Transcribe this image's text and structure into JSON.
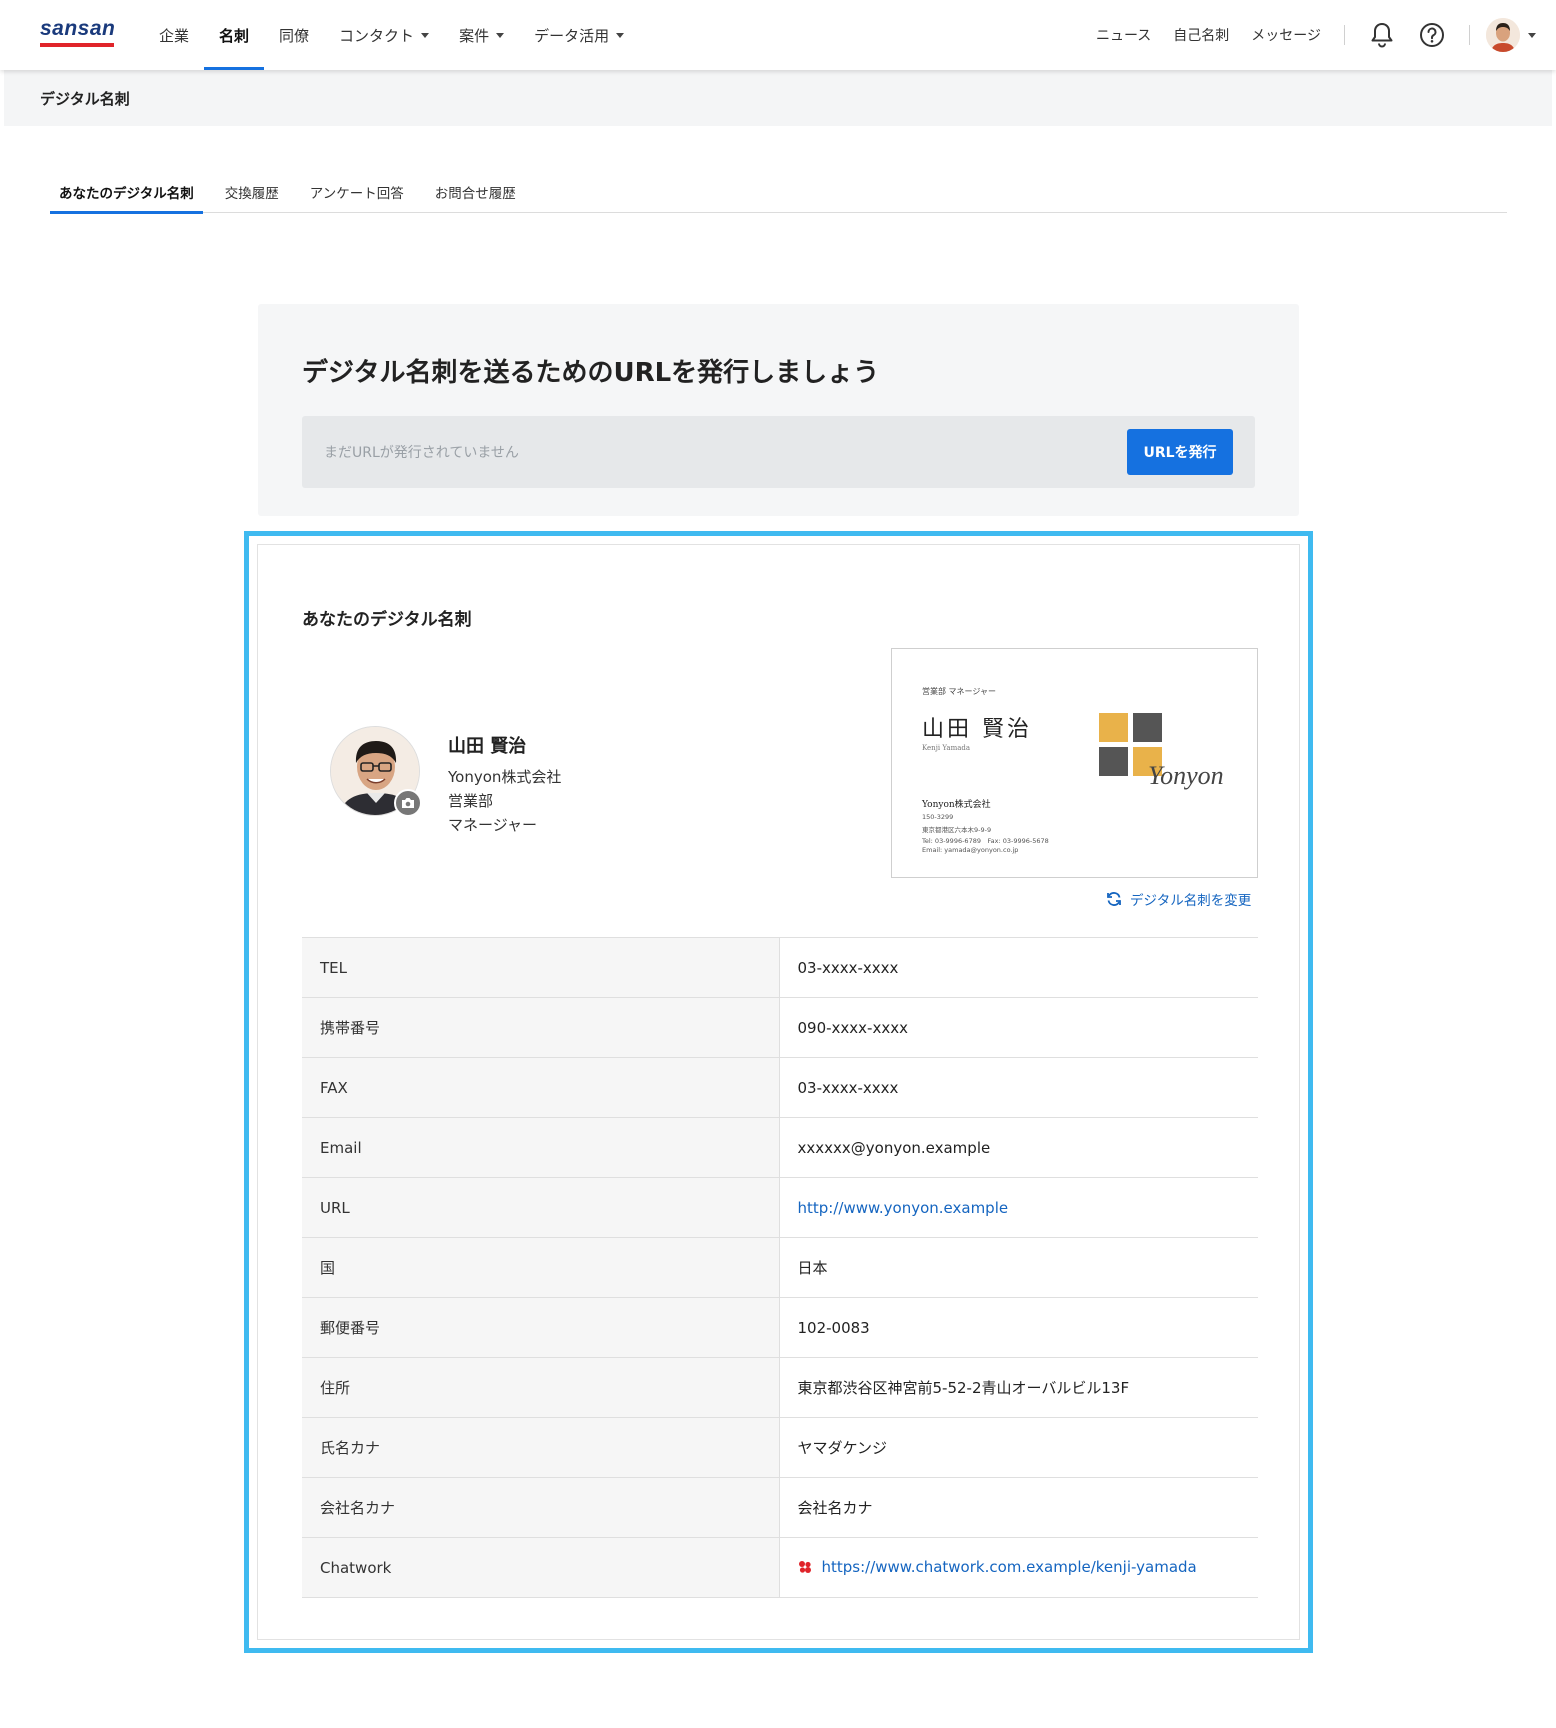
{
  "brand": {
    "logo_text": "sansan",
    "logo_red": "#e0242a",
    "logo_navy": "#1a3a7c"
  },
  "topnav": {
    "items": [
      {
        "label": "企業",
        "active": false
      },
      {
        "label": "名刺",
        "active": true
      },
      {
        "label": "同僚",
        "active": false
      },
      {
        "label": "コンタクト",
        "dropdown": true
      },
      {
        "label": "案件",
        "dropdown": true
      },
      {
        "label": "データ活用",
        "dropdown": true
      }
    ],
    "right_links": [
      "ニュース",
      "自己名刺",
      "メッセージ"
    ],
    "icons": [
      "bell-icon",
      "help-icon",
      "avatar",
      "chevron-down-icon"
    ]
  },
  "subheader": {
    "title": "デジタル名刺"
  },
  "tabs": [
    {
      "label": "あなたのデジタル名刺",
      "active": true
    },
    {
      "label": "交換履歴",
      "active": false
    },
    {
      "label": "アンケート回答",
      "active": false
    },
    {
      "label": "お問合せ履歴",
      "active": false
    }
  ],
  "url_panel": {
    "heading": "デジタル名刺を送るためのURLを発行しましょう",
    "placeholder": "まだURLが発行されていません",
    "button_label": "URLを発行"
  },
  "card": {
    "title": "あなたのデジタル名刺",
    "name": "山田 賢治",
    "company": "Yonyon株式会社",
    "department": "営業部",
    "position": "マネージャー",
    "change_link": "デジタル名刺を変更",
    "business_card": {
      "title": "営業部 マネージャー",
      "name": "山田 賢治",
      "roman_name": "Kenji Yamada",
      "logo_text": "Yonyon",
      "company": "Yonyon株式会社",
      "postal": "150-3299",
      "address": "東京都港区六本木9-9-9",
      "tel_fax": "Tel: 03-9996-6789　Fax: 03-9996-5678",
      "email": "Email: yamada@yonyon.co.jp",
      "logo_colors": {
        "gold": "#e9b24a",
        "gray": "#555555"
      }
    },
    "fields": [
      {
        "label": "TEL",
        "value": "03-xxxx-xxxx"
      },
      {
        "label": "携帯番号",
        "value": "090-xxxx-xxxx"
      },
      {
        "label": "FAX",
        "value": "03-xxxx-xxxx"
      },
      {
        "label": "Email",
        "value": "xxxxxx@yonyon.example"
      },
      {
        "label": "URL",
        "value": "http://www.yonyon.example",
        "link": true
      },
      {
        "label": "国",
        "value": "日本"
      },
      {
        "label": "郵便番号",
        "value": "102-0083"
      },
      {
        "label": "住所",
        "value": "東京都渋谷区神宮前5-52-2青山オーバルビル13F"
      },
      {
        "label": "氏名カナ",
        "value": "ヤマダケンジ"
      },
      {
        "label": "会社名カナ",
        "value": "会社名カナ"
      },
      {
        "label": "Chatwork",
        "value": "https://www.chatwork.com.example/kenji-yamada",
        "link": true,
        "icon": "chatwork-icon"
      }
    ]
  },
  "colors": {
    "accent": "#1571e0",
    "highlight_frame": "#3fbaf0",
    "link": "#1565c0"
  }
}
